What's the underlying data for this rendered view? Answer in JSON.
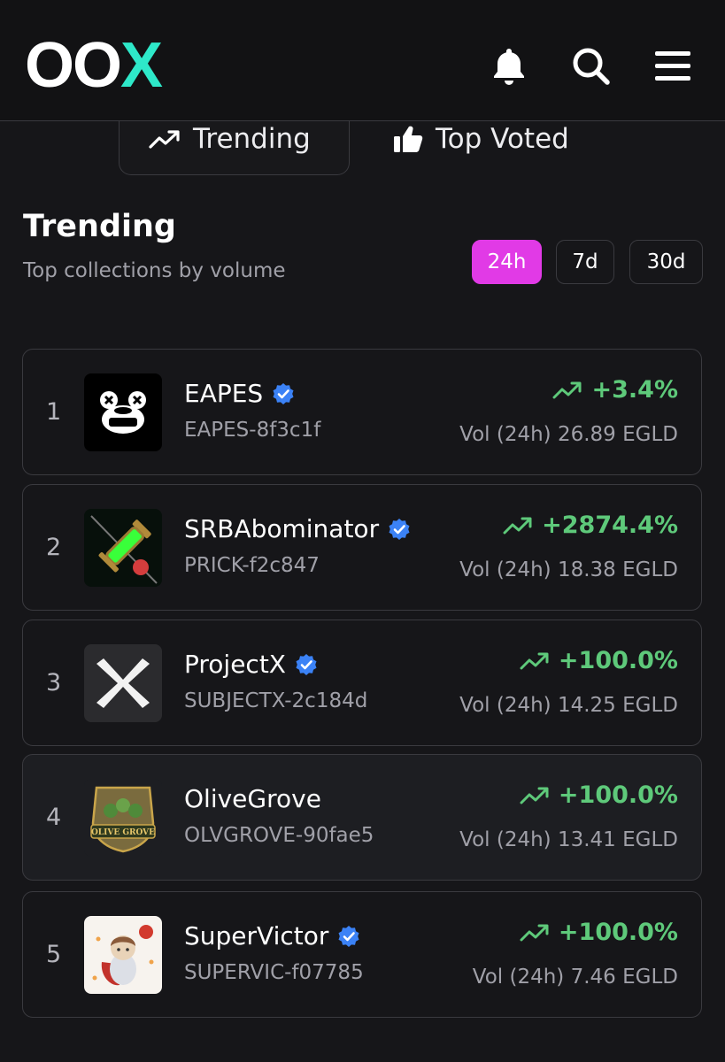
{
  "header": {
    "logo_main": "OO",
    "logo_accent": "X",
    "icons": [
      "bell-icon",
      "search-icon",
      "menu-icon"
    ]
  },
  "tabs": [
    {
      "label": "Trending",
      "icon": "trending-up-icon",
      "active": true
    },
    {
      "label": "Top Voted",
      "icon": "thumbs-up-icon",
      "active": false
    }
  ],
  "section": {
    "title": "Trending",
    "subtitle": "Top collections by volume"
  },
  "periods": [
    {
      "label": "24h",
      "active": true
    },
    {
      "label": "7d",
      "active": false
    },
    {
      "label": "30d",
      "active": false
    }
  ],
  "collections": [
    {
      "rank": "1",
      "name": "EAPES",
      "ticker": "EAPES-8f3c1f",
      "change": "+3.4%",
      "volume": "Vol (24h) 26.89 EGLD",
      "verified": true
    },
    {
      "rank": "2",
      "name": "SRBAbominator",
      "ticker": "PRICK-f2c847",
      "change": "+2874.4%",
      "volume": "Vol (24h) 18.38 EGLD",
      "verified": true
    },
    {
      "rank": "3",
      "name": "ProjectX",
      "ticker": "SUBJECTX-2c184d",
      "change": "+100.0%",
      "volume": "Vol (24h) 14.25 EGLD",
      "verified": true
    },
    {
      "rank": "4",
      "name": "OliveGrove",
      "ticker": "OLVGROVE-90fae5",
      "change": "+100.0%",
      "volume": "Vol (24h) 13.41 EGLD",
      "verified": false,
      "thumb_text": "OLIVE GROVE"
    },
    {
      "rank": "5",
      "name": "SuperVictor",
      "ticker": "SUPERVIC-f07785",
      "change": "+100.0%",
      "volume": "Vol (24h) 7.46 EGLD",
      "verified": true
    }
  ],
  "colors": {
    "accent_logo": "#2ee8c9",
    "active_period": "#e13ae6",
    "positive": "#5ec97a",
    "verified": "#3b82f6",
    "background": "#161619"
  }
}
